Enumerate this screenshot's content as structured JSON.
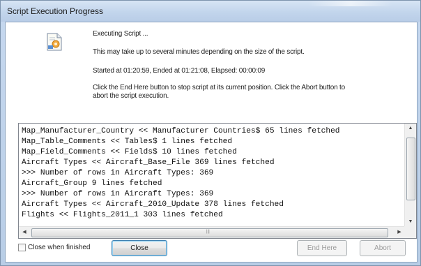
{
  "window": {
    "title": "Script Execution Progress"
  },
  "info": {
    "status": "Executing Script ...",
    "note": "This may take up to several minutes depending on the size of the script.",
    "timing": "Started at 01:20:59, Ended at 01:21:08,  Elapsed: 00:00:09",
    "help": "Click the End Here button to stop script at its current position. Click the Abort button to abort the script execution."
  },
  "log": {
    "lines": [
      "Map_Manufacturer_Country << Manufacturer Countries$ 65 lines fetched",
      "Map_Table_Comments << Tables$ 1 lines fetched",
      "Map_Field_Comments << Fields$ 10 lines fetched",
      "Aircraft Types << Aircraft_Base_File 369 lines fetched",
      ">>> Number of rows in Aircraft Types: 369",
      "Aircraft_Group 9 lines fetched",
      ">>> Number of rows in Aircraft Types: 369",
      "Aircraft Types << Aircraft_2010_Update 378 lines fetched",
      "Flights << Flights_2011_1 303 lines fetched"
    ]
  },
  "footer": {
    "close_when_finished_label": "Close when finished",
    "close_when_finished_checked": false,
    "close_label": "Close",
    "end_here_label": "End Here",
    "abort_label": "Abort"
  }
}
